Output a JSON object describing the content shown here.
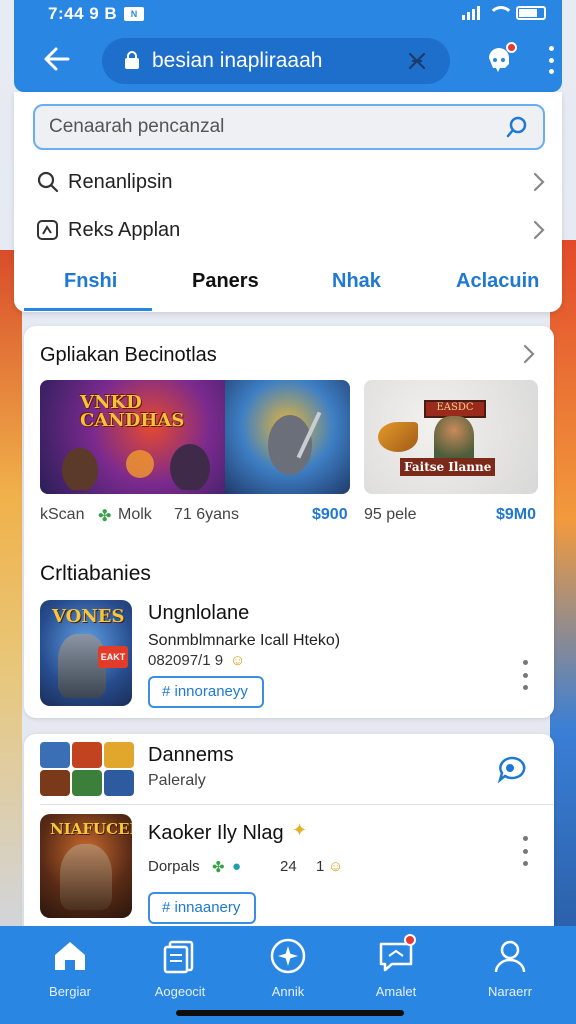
{
  "status_bar": {
    "time": "7:44 9 B",
    "sim_label": "N"
  },
  "app_bar": {
    "url": "besian inapliraaah"
  },
  "search": {
    "placeholder": "Cenaarah pencanzal"
  },
  "suggestions": [
    {
      "label": "Renanlipsin",
      "icon": "search-icon"
    },
    {
      "label": "Reks Applan",
      "icon": "app-square-icon"
    }
  ],
  "tabs": [
    {
      "label": "Fnshi",
      "active": true,
      "color": "#1f78d1"
    },
    {
      "label": "Paners",
      "active": false,
      "color": "#111111"
    },
    {
      "label": "Nhak",
      "active": false,
      "color": "#1f78d1"
    },
    {
      "label": "Aclacuin",
      "active": false,
      "color": "#1f78d1"
    }
  ],
  "featured": {
    "title": "Gpliakan Becinotlas",
    "banner1_logo": "VNKD CANDHAS",
    "banner2_sign": "EASDC",
    "banner2_logo": "Faitse Ilanne",
    "item1": {
      "rating": "kScan",
      "seller": "Molk",
      "installs": "71 6yans",
      "price": "$900"
    },
    "item2": {
      "installs": "95 pele",
      "price": "$9M0"
    }
  },
  "collections": {
    "title": "Crltiabanies",
    "app1": {
      "icon_text": "VONES",
      "icon_badge": "EAKT",
      "name": "Ungnlolane",
      "subtitle": "Sonmblmnarke Icall Hteko)",
      "stats": "082097/1 9",
      "tag": "# innoraneyy"
    }
  },
  "card2": {
    "header_name": "Dannems",
    "header_sub": "Paleraly",
    "app2": {
      "icon_text": "NIAFUCEE",
      "name": "Kaoker Ily Nlag",
      "stats_prefix": "Dorpals",
      "stats_num1": "24",
      "stats_num2": "1",
      "tag": "# innaanery"
    }
  },
  "bottom_nav": [
    {
      "label": "Bergiar",
      "icon": "home-icon"
    },
    {
      "label": "Aogeocit",
      "icon": "library-icon"
    },
    {
      "label": "Annik",
      "icon": "compass-icon"
    },
    {
      "label": "Amalet",
      "icon": "message-icon",
      "badge": true
    },
    {
      "label": "Naraerr",
      "icon": "profile-icon"
    }
  ],
  "colors": {
    "brand": "#2a86e3",
    "accent": "#1f78d1",
    "badge": "#e53935"
  }
}
